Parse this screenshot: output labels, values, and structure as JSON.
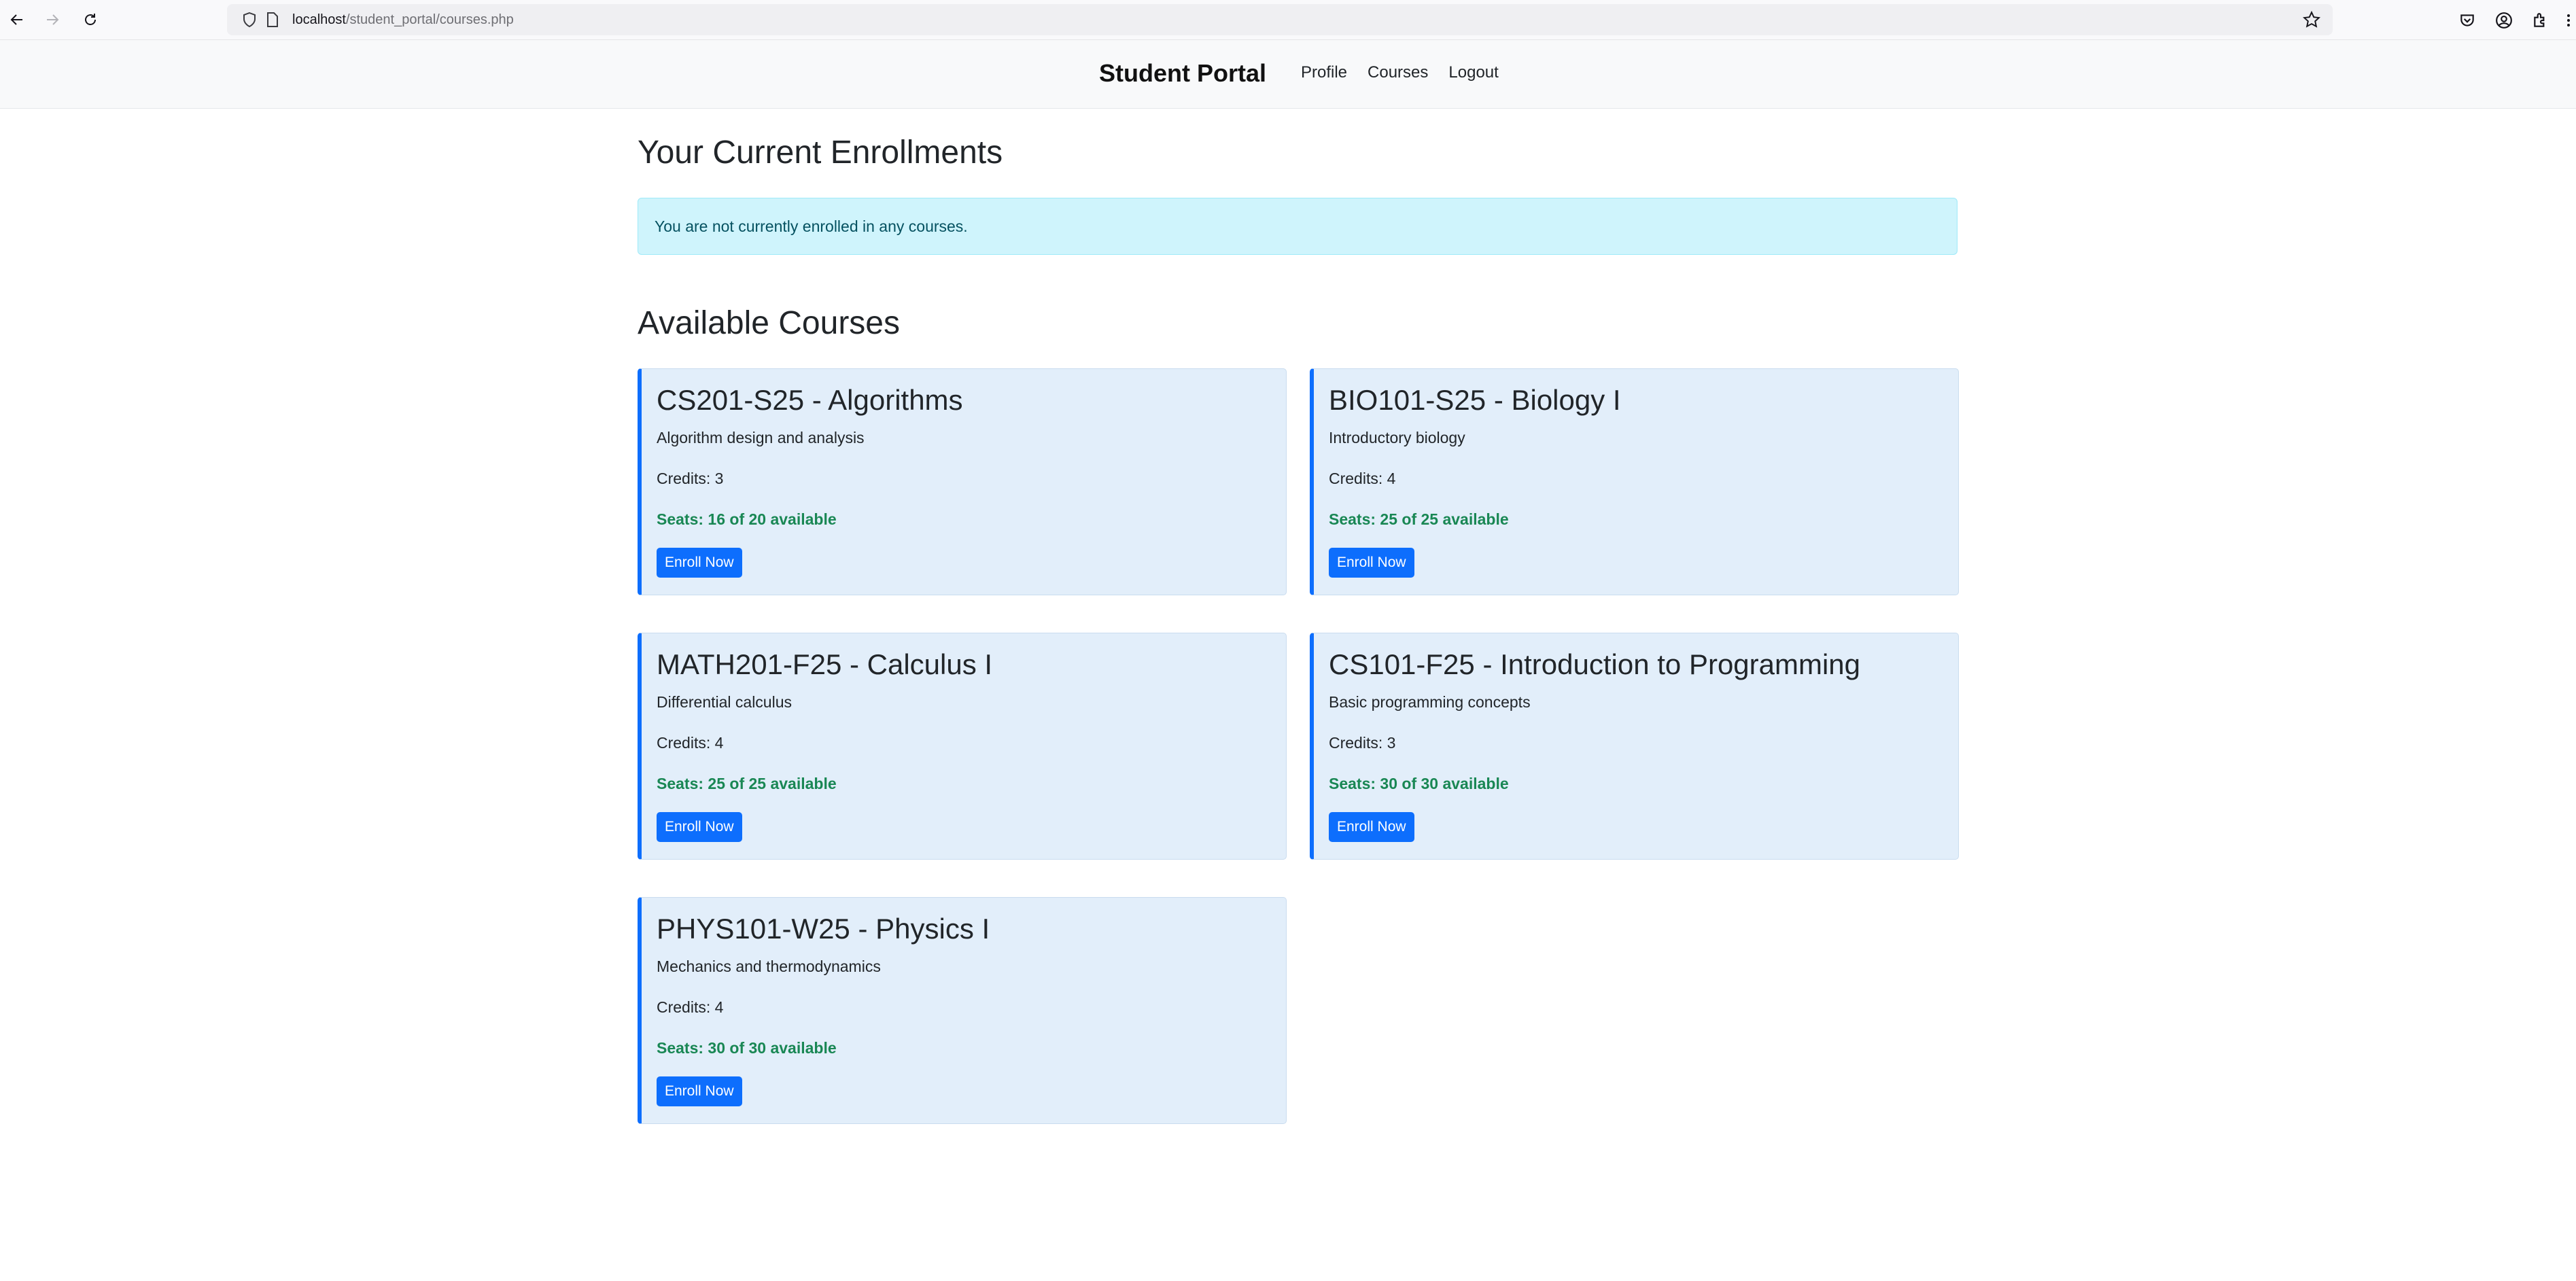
{
  "browser": {
    "url_host": "localhost",
    "url_path": "/student_portal/courses.php"
  },
  "navbar": {
    "brand": "Student Portal",
    "links": [
      "Profile",
      "Courses",
      "Logout"
    ]
  },
  "enrollments": {
    "heading": "Your Current Enrollments",
    "alert": "You are not currently enrolled in any courses."
  },
  "available": {
    "heading": "Available Courses",
    "courses": [
      {
        "title": "CS201-S25 - Algorithms",
        "description": "Algorithm design and analysis",
        "credits": "Credits: 3",
        "seats": "Seats: 16 of 20 available",
        "button": "Enroll Now"
      },
      {
        "title": "BIO101-S25 - Biology I",
        "description": "Introductory biology",
        "credits": "Credits: 4",
        "seats": "Seats: 25 of 25 available",
        "button": "Enroll Now"
      },
      {
        "title": "MATH201-F25 - Calculus I",
        "description": "Differential calculus",
        "credits": "Credits: 4",
        "seats": "Seats: 25 of 25 available",
        "button": "Enroll Now"
      },
      {
        "title": "CS101-F25 - Introduction to Programming",
        "description": "Basic programming concepts",
        "credits": "Credits: 3",
        "seats": "Seats: 30 of 30 available",
        "button": "Enroll Now"
      },
      {
        "title": "PHYS101-W25 - Physics I",
        "description": "Mechanics and thermodynamics",
        "credits": "Credits: 4",
        "seats": "Seats: 30 of 30 available",
        "button": "Enroll Now"
      }
    ]
  },
  "colors": {
    "accent": "#0d6efd",
    "card_bg": "#e2eefa",
    "seats_green": "#198754",
    "alert_bg": "#cff4fc"
  }
}
